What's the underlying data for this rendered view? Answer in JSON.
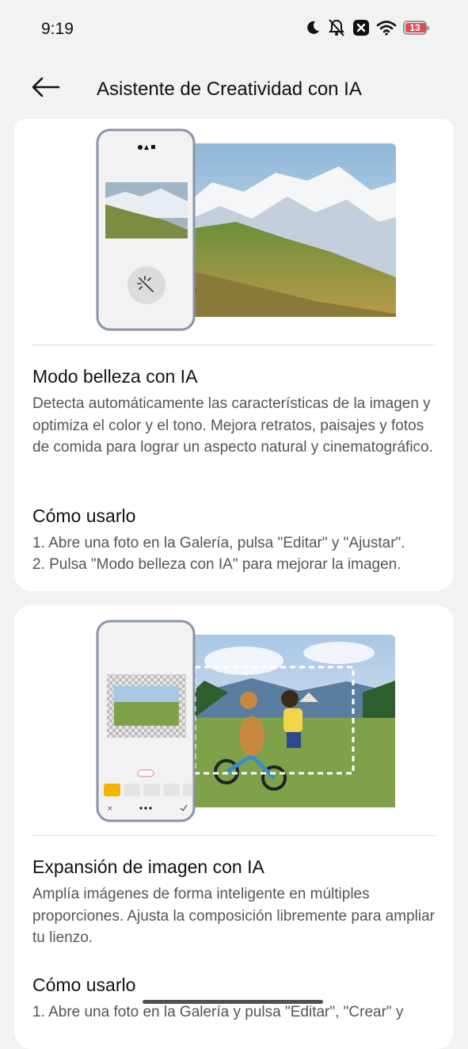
{
  "status": {
    "time": "9:19",
    "battery": "13",
    "icons": [
      "moon-icon",
      "bell-off-icon",
      "close-box-icon",
      "wifi-icon",
      "battery-icon"
    ]
  },
  "appbar": {
    "title": "Asistente de Creatividad con IA",
    "back_icon": "arrow-left-icon"
  },
  "cards": [
    {
      "heading": "Modo belleza con IA",
      "description": "Detecta automáticamente las características de la imagen y optimiza el color y el tono. Mejora retratos, paisajes y fotos de comida para lograr un aspecto natural y cinematográfico.",
      "howto_heading": "Cómo usarlo",
      "steps": [
        "1. Abre una foto en la Galería, pulsa \"Editar\" y \"Ajustar\".",
        "2. Pulsa \"Modo belleza con IA\" para mejorar la imagen."
      ]
    },
    {
      "heading": "Expansión de imagen con IA",
      "description": "Amplía imágenes de forma inteligente en múltiples proporciones. Ajusta la composición libremente para ampliar tu lienzo.",
      "howto_heading": "Cómo usarlo",
      "steps": [
        "1. Abre una foto en la Galería y pulsa \"Editar\", \"Crear\" y"
      ]
    }
  ]
}
